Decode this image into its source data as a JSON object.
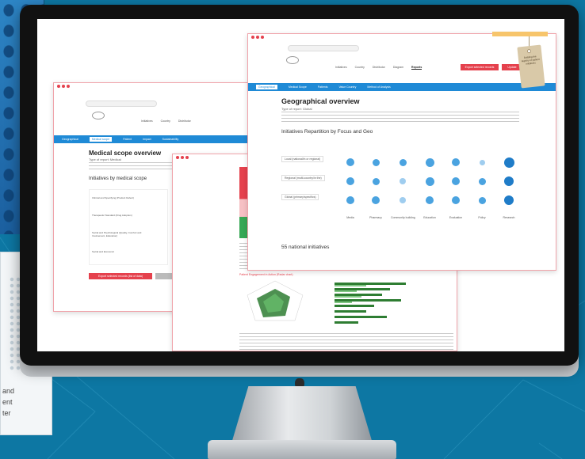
{
  "background": {
    "caption_lines": [
      "and",
      "ent",
      "ter"
    ]
  },
  "windows": {
    "medical": {
      "title": "Medical scope overview",
      "subtitle": "Type of report: Medical",
      "section": "Initiatives by medical scope",
      "nav": [
        "Medical scope",
        "Geographical",
        "Patient",
        "Impact",
        "Sustainability"
      ],
      "rows": [
        "Clinical and Specifying (Product Defect)",
        "Therapeutic Standard (Drug Adoption)",
        "Social and Psychological (Quality, Comfort and Involvement, Education)",
        "Social and Economic"
      ],
      "buttons": [
        "Export selected records (list of data)"
      ]
    },
    "geo": {
      "title": "Geographical overview",
      "subtitle": "Type of report: Global",
      "section": "Initiatives Repartition by Focus and Geo",
      "footer": "55 national initiatives",
      "nav_top": [
        "Initiatives",
        "Country",
        "Distributor",
        "Diagram"
      ],
      "nav_top_active": "Reports",
      "nav_blue": [
        "Geographical",
        "Medical Scope",
        "Patients",
        "Value Country",
        "Method of Analysis"
      ],
      "btn_primary": "Export selected records",
      "btn_secondary": "Update",
      "row_labels": [
        "Local (national/in or regional)",
        "Regional (multi-country/in the)",
        "Global (primary/specifics)"
      ],
      "col_labels": [
        "Media",
        "Pharmacy",
        "Community building",
        "Education",
        "Evaluation",
        "Policy",
        "Research"
      ],
      "tag_text": "Building the registry of patient initiatives"
    },
    "doc": {
      "chart_heading": "Patient Engagement in Action (Radar chart)"
    }
  },
  "colors": {
    "accent_blue": "#1f8ad6",
    "accent_red": "#e5414d",
    "bubble_dark": "#1f7cc8",
    "bubble_mid": "#4aa3e0",
    "bubble_light": "#9fcdef",
    "chart_green": "#2e7d32"
  }
}
